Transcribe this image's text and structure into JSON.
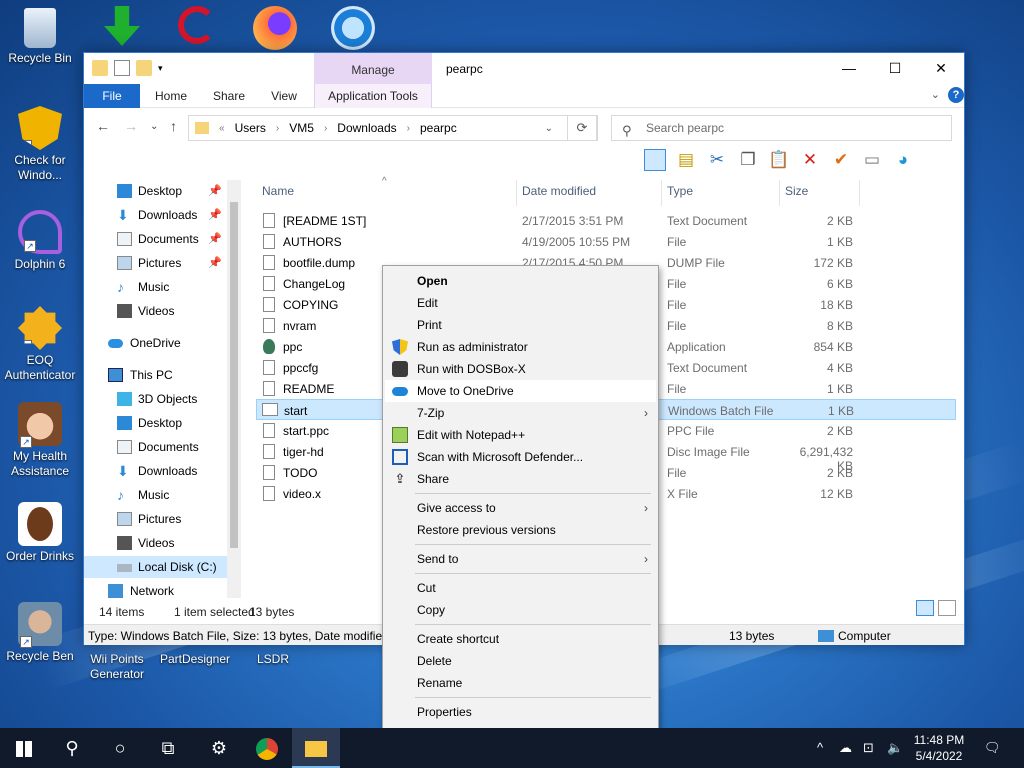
{
  "desktop": {
    "icons": [
      {
        "label": "Recycle Bin"
      },
      {
        "label": "Check for Windo..."
      },
      {
        "label": "Dolphin 6"
      },
      {
        "label": "EOQ Authenticator"
      },
      {
        "label": "My Health Assistance"
      },
      {
        "label": "Order Drinks"
      },
      {
        "label": "Recycle Ben"
      },
      {
        "label": "Wii Points Generator"
      },
      {
        "label": "PartDesigner"
      },
      {
        "label": "LSDR"
      }
    ]
  },
  "window": {
    "title": "pearpc",
    "manage_label": "Manage",
    "tabs": {
      "file": "File",
      "home": "Home",
      "share": "Share",
      "view": "View",
      "app_tools": "Application Tools"
    },
    "controls": {
      "minimize": "—",
      "maximize": "☐",
      "close": "✕"
    },
    "address": {
      "prefix": "«",
      "crumbs": [
        "Users",
        "VM5",
        "Downloads",
        "pearpc"
      ]
    },
    "search_placeholder": "Search pearpc",
    "nav": [
      {
        "label": "Desktop",
        "pinned": true
      },
      {
        "label": "Downloads",
        "pinned": true
      },
      {
        "label": "Documents",
        "pinned": true
      },
      {
        "label": "Pictures",
        "pinned": true
      },
      {
        "label": "Music"
      },
      {
        "label": "Videos"
      },
      {
        "label": "OneDrive"
      },
      {
        "label": "This PC"
      },
      {
        "label": "3D Objects"
      },
      {
        "label": "Desktop"
      },
      {
        "label": "Documents"
      },
      {
        "label": "Downloads"
      },
      {
        "label": "Music"
      },
      {
        "label": "Pictures"
      },
      {
        "label": "Videos"
      },
      {
        "label": "Local Disk (C:)"
      },
      {
        "label": "Network"
      }
    ],
    "columns": {
      "name": "Name",
      "date": "Date modified",
      "type": "Type",
      "size": "Size"
    },
    "files": [
      {
        "name": "[README 1ST]",
        "date": "2/17/2015 3:51 PM",
        "type": "Text Document",
        "size": "2 KB"
      },
      {
        "name": "AUTHORS",
        "date": "4/19/2005 10:55 PM",
        "type": "File",
        "size": "1 KB"
      },
      {
        "name": "bootfile.dump",
        "date": "2/17/2015 4:50 PM",
        "type": "DUMP File",
        "size": "172 KB"
      },
      {
        "name": "ChangeLog",
        "date": "",
        "type": "File",
        "size": "6 KB"
      },
      {
        "name": "COPYING",
        "date": "",
        "type": "File",
        "size": "18 KB"
      },
      {
        "name": "nvram",
        "date": "",
        "type": "File",
        "size": "8 KB"
      },
      {
        "name": "ppc",
        "date": "",
        "type": "Application",
        "size": "854 KB"
      },
      {
        "name": "ppccfg",
        "date": "",
        "type": "Text Document",
        "size": "4 KB"
      },
      {
        "name": "README",
        "date": "",
        "type": "File",
        "size": "1 KB"
      },
      {
        "name": "start",
        "date": "",
        "type": "Windows Batch File",
        "size": "1 KB"
      },
      {
        "name": "start.ppc",
        "date": "",
        "type": "PPC File",
        "size": "2 KB"
      },
      {
        "name": "tiger-hd",
        "date": "",
        "type": "Disc Image File",
        "size": "6,291,432 KB"
      },
      {
        "name": "TODO",
        "date": "",
        "type": "File",
        "size": "2 KB"
      },
      {
        "name": "video.x",
        "date": "",
        "type": "X File",
        "size": "12 KB"
      }
    ],
    "status": {
      "count": "14 items",
      "selected": "1 item selected",
      "bytes": "13 bytes"
    },
    "details": {
      "text": "Type: Windows Batch File, Size: 13 bytes, Date modified:",
      "size": "13 bytes",
      "location": "Computer"
    }
  },
  "context_menu": {
    "items": [
      {
        "label": "Open"
      },
      {
        "label": "Edit"
      },
      {
        "label": "Print"
      },
      {
        "label": "Run as administrator"
      },
      {
        "label": "Run with DOSBox-X"
      },
      {
        "label": "Move to OneDrive"
      },
      {
        "label": "7-Zip"
      },
      {
        "label": "Edit with Notepad++"
      },
      {
        "label": "Scan with Microsoft Defender..."
      },
      {
        "label": "Share"
      },
      {
        "label": "Give access to"
      },
      {
        "label": "Restore previous versions"
      },
      {
        "label": "Send to"
      },
      {
        "label": "Cut"
      },
      {
        "label": "Copy"
      },
      {
        "label": "Create shortcut"
      },
      {
        "label": "Delete"
      },
      {
        "label": "Rename"
      },
      {
        "label": "Properties"
      }
    ],
    "arrow": "›"
  },
  "taskbar": {
    "time": "11:48 PM",
    "date": "5/4/2022"
  },
  "colors": {
    "accent": "#1b6ac9",
    "selection": "#cce8ff",
    "manage_band": "#e8d7f4"
  }
}
